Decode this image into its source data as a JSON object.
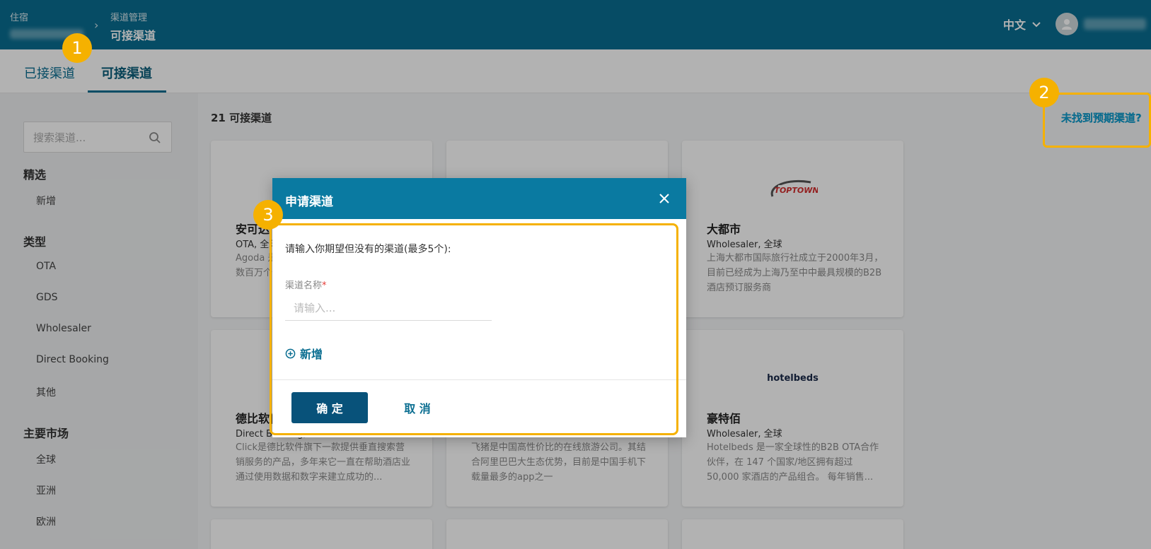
{
  "header": {
    "crumb1_label": "住宿",
    "crumb_sep": "›",
    "crumb2_label": "渠道管理",
    "crumb2_current": "可接渠道",
    "language": "中文"
  },
  "tabs": [
    {
      "label": "已接渠道"
    },
    {
      "label": "可接渠道"
    }
  ],
  "sidebar": {
    "search_placeholder": "搜索渠道...",
    "featured_title": "精选",
    "featured_items": [
      "新增"
    ],
    "type_title": "类型",
    "type_items": [
      "OTA",
      "GDS",
      "Wholesaler",
      "Direct Booking",
      "其他"
    ],
    "market_title": "主要市场",
    "market_items": [
      "全球",
      "亚洲",
      "欧洲"
    ]
  },
  "main": {
    "count_label": "21 可接渠道",
    "not_found_link": "未找到预期渠道?"
  },
  "cards": [
    {
      "name": "安可达",
      "meta": "OTA, 全球",
      "desc": "Agoda 是全球酒店预订平台，为旅客提供数百万个目的地住宿"
    },
    {
      "name": "",
      "meta": "",
      "desc": ""
    },
    {
      "name": "大都市",
      "meta": "Wholesaler, 全球",
      "desc": "上海大都市国际旅行社成立于2000年3月，目前已经成为上海乃至中中最具规模的B2B酒店预订服务商",
      "logo_text": "TOPTOWN"
    },
    {
      "name": "德比软件",
      "meta": "Direct Booking, 全球",
      "desc": "Click是德比软件旗下一款提供垂直搜索营销服务的产品，多年来它一直在帮助酒店业通过使用数据和数字来建立成功的..."
    },
    {
      "name": "",
      "meta": "",
      "desc": "飞猪是中国高性价比的在线旅游公司。其结合阿里巴巴大生态优势，目前是中国手机下载量最多的app之一"
    },
    {
      "name": "豪特佰",
      "meta": "Wholesaler, 全球",
      "desc": "Hotelbeds 是一家全球性的B2B OTA合作伙伴，在 147 个国家/地区拥有超过 50,000 家酒店的产品组合。 每年销售...",
      "logo_text": "hotelbeds"
    }
  ],
  "dialog": {
    "title": "申请渠道",
    "intro": "请输入你期望但没有的渠道(最多5个):",
    "field_label": "渠道名称",
    "required_mark": "*",
    "input_placeholder": "请输入...",
    "add_label": "新增",
    "ok_label": "确 定",
    "cancel_label": "取 消"
  },
  "badges": [
    "1",
    "2",
    "3"
  ],
  "colors": {
    "header_bg": "#0a6e91",
    "highlight": "#f5b100",
    "primary_button": "#08527a"
  }
}
